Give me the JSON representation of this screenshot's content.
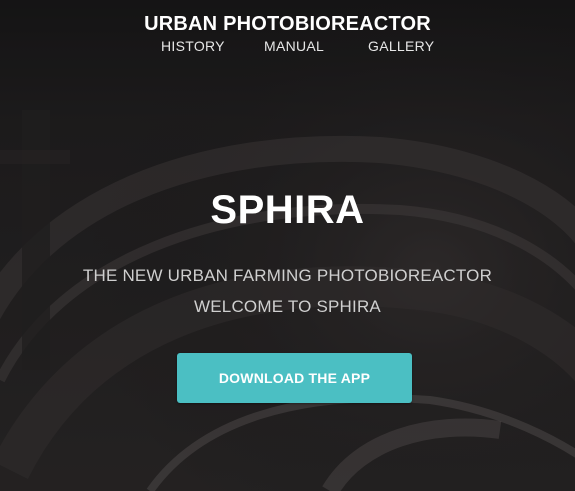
{
  "header": {
    "title": "URBAN PHOTOBIOREACTOR",
    "nav": {
      "history": "HISTORY",
      "manual": "MANUAL",
      "gallery": "GALLERY"
    }
  },
  "hero": {
    "title": "SPHIRA",
    "tagline_line1": "THE NEW URBAN FARMING PHOTOBIOREACTOR",
    "tagline_line2": "WELCOME TO SPHIRA",
    "cta_label": "DOWNLOAD THE APP"
  },
  "colors": {
    "accent": "#4bbfc3",
    "background": "#1f1d1e",
    "text": "#ffffff",
    "subtext": "#cfcfcf"
  }
}
